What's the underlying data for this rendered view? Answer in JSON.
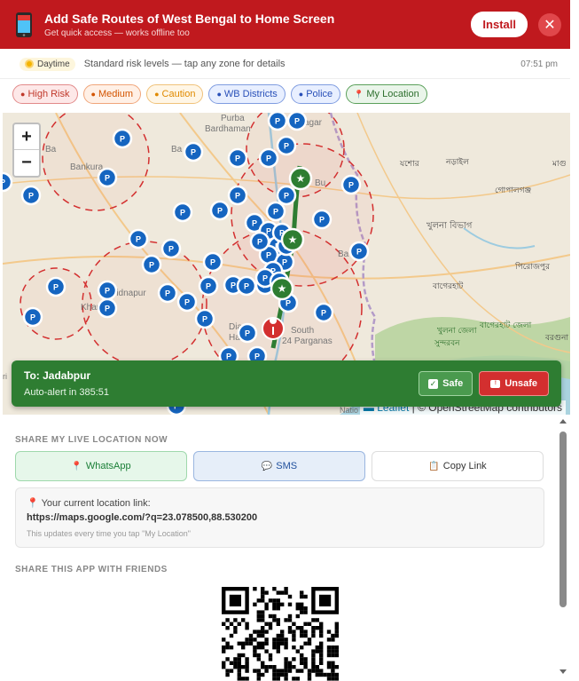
{
  "banner": {
    "title": "Add Safe Routes of West Bengal to Home Screen",
    "subtitle": "Get quick access — works offline too",
    "install_label": "Install",
    "close_icon": "close-icon",
    "phone_icon": "phone-icon",
    "colors": {
      "background": "#c0191e"
    }
  },
  "status": {
    "mode_label": "Daytime",
    "mode_icon": "sun-icon",
    "description": "Standard risk levels — tap any zone for details",
    "time": "07:51 pm"
  },
  "filters": [
    {
      "label": "High Risk",
      "dot": "●"
    },
    {
      "label": "Medium",
      "dot": "●"
    },
    {
      "label": "Caution",
      "dot": "●"
    },
    {
      "label": "WB Districts",
      "dot": "●"
    },
    {
      "label": "Police",
      "dot": "●"
    },
    {
      "label": "My Location",
      "dot": "📍"
    }
  ],
  "map": {
    "zoom_in": "+",
    "zoom_out": "−",
    "attribution_leaflet": "Leaflet",
    "attribution_osm": "| © OpenStreetMap contributors",
    "police_marker_label": "P",
    "place_labels": {
      "purba": "Purba",
      "bardhaman": "Bardhaman",
      "bankura": "Bankura",
      "midnapur": "Midnapur",
      "kharagpur": "Khar",
      "barddhaman_short": "Ba",
      "bu": "Bu",
      "dia": "Dia",
      "har": "Ha",
      "nagar": "agar",
      "ba2": "Ba",
      "south": "South",
      "parganas": "24 Parganas",
      "khulna_div": "খুলনা বিভাগ",
      "jessore": "যশোর",
      "narail": "নড়াইল",
      "magura": "মাগু",
      "gopalganj": "গোপালগঞ্জ",
      "pirojpur": "পিরোজপুর",
      "bagerhat": "বাগেরহাট",
      "khulna_dist": "খুলনা জেলা",
      "sundarban": "সুন্দরবন",
      "bagerhat_dist": "বাগেরহাট জেলা",
      "barguna": "বরগুনা",
      "nation": "Natio",
      "tri": "ri"
    },
    "colors": {
      "high": "#d32f2f",
      "police": "#1565c0",
      "land": "#efe9dc",
      "water": "#aad3df",
      "forest": "#b5d29b"
    }
  },
  "route": {
    "to_label": "To: Jadabpur",
    "alert_label": "Auto-alert in 385:51",
    "safe_label": "Safe",
    "unsafe_label": "Unsafe",
    "safe_icon": "checkbox-icon",
    "unsafe_icon": "sos-icon"
  },
  "share": {
    "heading": "SHARE MY LIVE LOCATION NOW",
    "whatsapp_label": "WhatsApp",
    "sms_label": "SMS",
    "copy_label": "Copy Link",
    "location_label": "Your current location link:",
    "location_url": "https://maps.google.com/?q=23.078500,88.530200",
    "note": "This updates every time you tap \"My Location\""
  },
  "share_app": {
    "heading": "SHARE THIS APP WITH FRIENDS",
    "qr_icon": "qr-code-icon"
  }
}
